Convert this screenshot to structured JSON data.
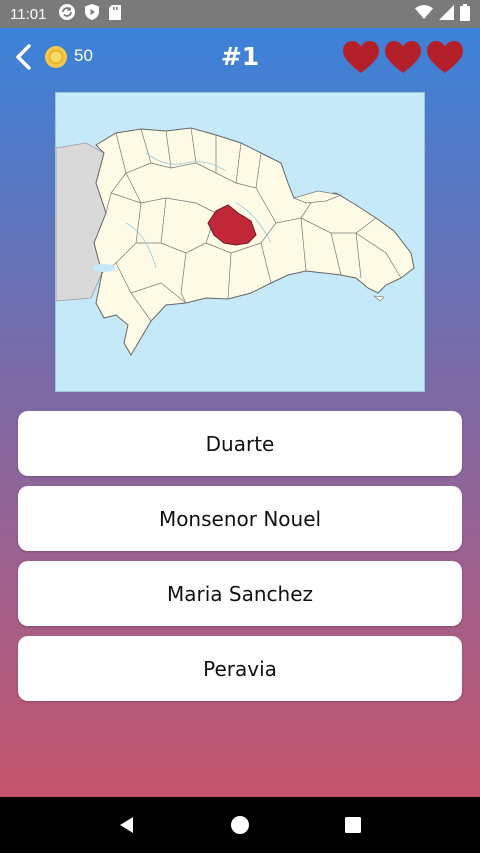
{
  "status_bar": {
    "time": "11:01",
    "icons_left": [
      "sync-icon",
      "shield-play-icon",
      "sd-card-icon"
    ],
    "icons_right": [
      "wifi-icon",
      "cellular-icon",
      "battery-icon"
    ]
  },
  "header": {
    "coins": "50",
    "question_number": "#1",
    "lives": 3,
    "coin_color": "#f2c94c",
    "heart_color": "#b3202a"
  },
  "map": {
    "highlight_color": "#c0283a",
    "land_color": "#fdfbe5",
    "sea_color": "#c6e9fa",
    "neighbor_color": "#d9d9d9"
  },
  "answers": [
    {
      "label": "Duarte"
    },
    {
      "label": "Monsenor Nouel"
    },
    {
      "label": "Maria Sanchez"
    },
    {
      "label": "Peravia"
    }
  ],
  "nav": {
    "icons": [
      "back-triangle-icon",
      "home-circle-icon",
      "recents-square-icon"
    ]
  }
}
